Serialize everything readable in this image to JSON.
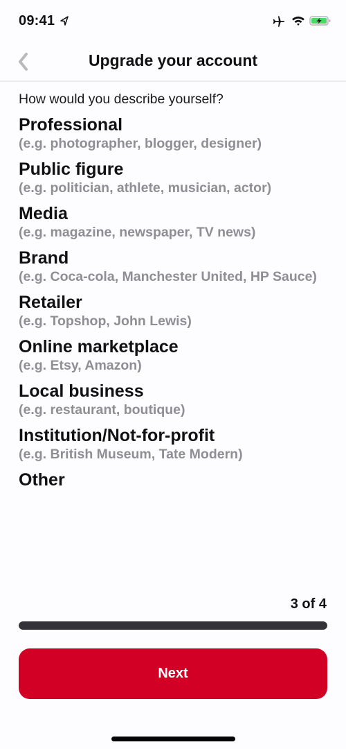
{
  "status_bar": {
    "time": "09:41",
    "icons": [
      "location-arrow-icon",
      "airplane-icon",
      "wifi-icon",
      "battery-charging-icon"
    ],
    "battery_color": "#4cd964"
  },
  "nav": {
    "back_icon": "chevron-left-icon",
    "title": "Upgrade your account"
  },
  "question": "How would you describe yourself?",
  "options": [
    {
      "title": "Professional",
      "subtitle": "(e.g. photographer, blogger, designer)"
    },
    {
      "title": "Public figure",
      "subtitle": "(e.g. politician, athlete, musician, actor)"
    },
    {
      "title": "Media",
      "subtitle": "(e.g. magazine, newspaper, TV news)"
    },
    {
      "title": "Brand",
      "subtitle": "(e.g. Coca-cola, Manchester United, HP Sauce)"
    },
    {
      "title": "Retailer",
      "subtitle": "(e.g. Topshop, John Lewis)"
    },
    {
      "title": "Online marketplace",
      "subtitle": "(e.g. Etsy, Amazon)"
    },
    {
      "title": "Local business",
      "subtitle": "(e.g. restaurant, boutique)"
    },
    {
      "title": "Institution/Not-for-profit",
      "subtitle": "(e.g. British Museum, Tate Modern)"
    },
    {
      "title": "Other",
      "subtitle": ""
    }
  ],
  "progress": {
    "label": "3 of 4",
    "current_step": 3,
    "total_steps": 4,
    "visible_fill_fraction": 1.0
  },
  "next_button": {
    "label": "Next",
    "color": "#d10024"
  }
}
